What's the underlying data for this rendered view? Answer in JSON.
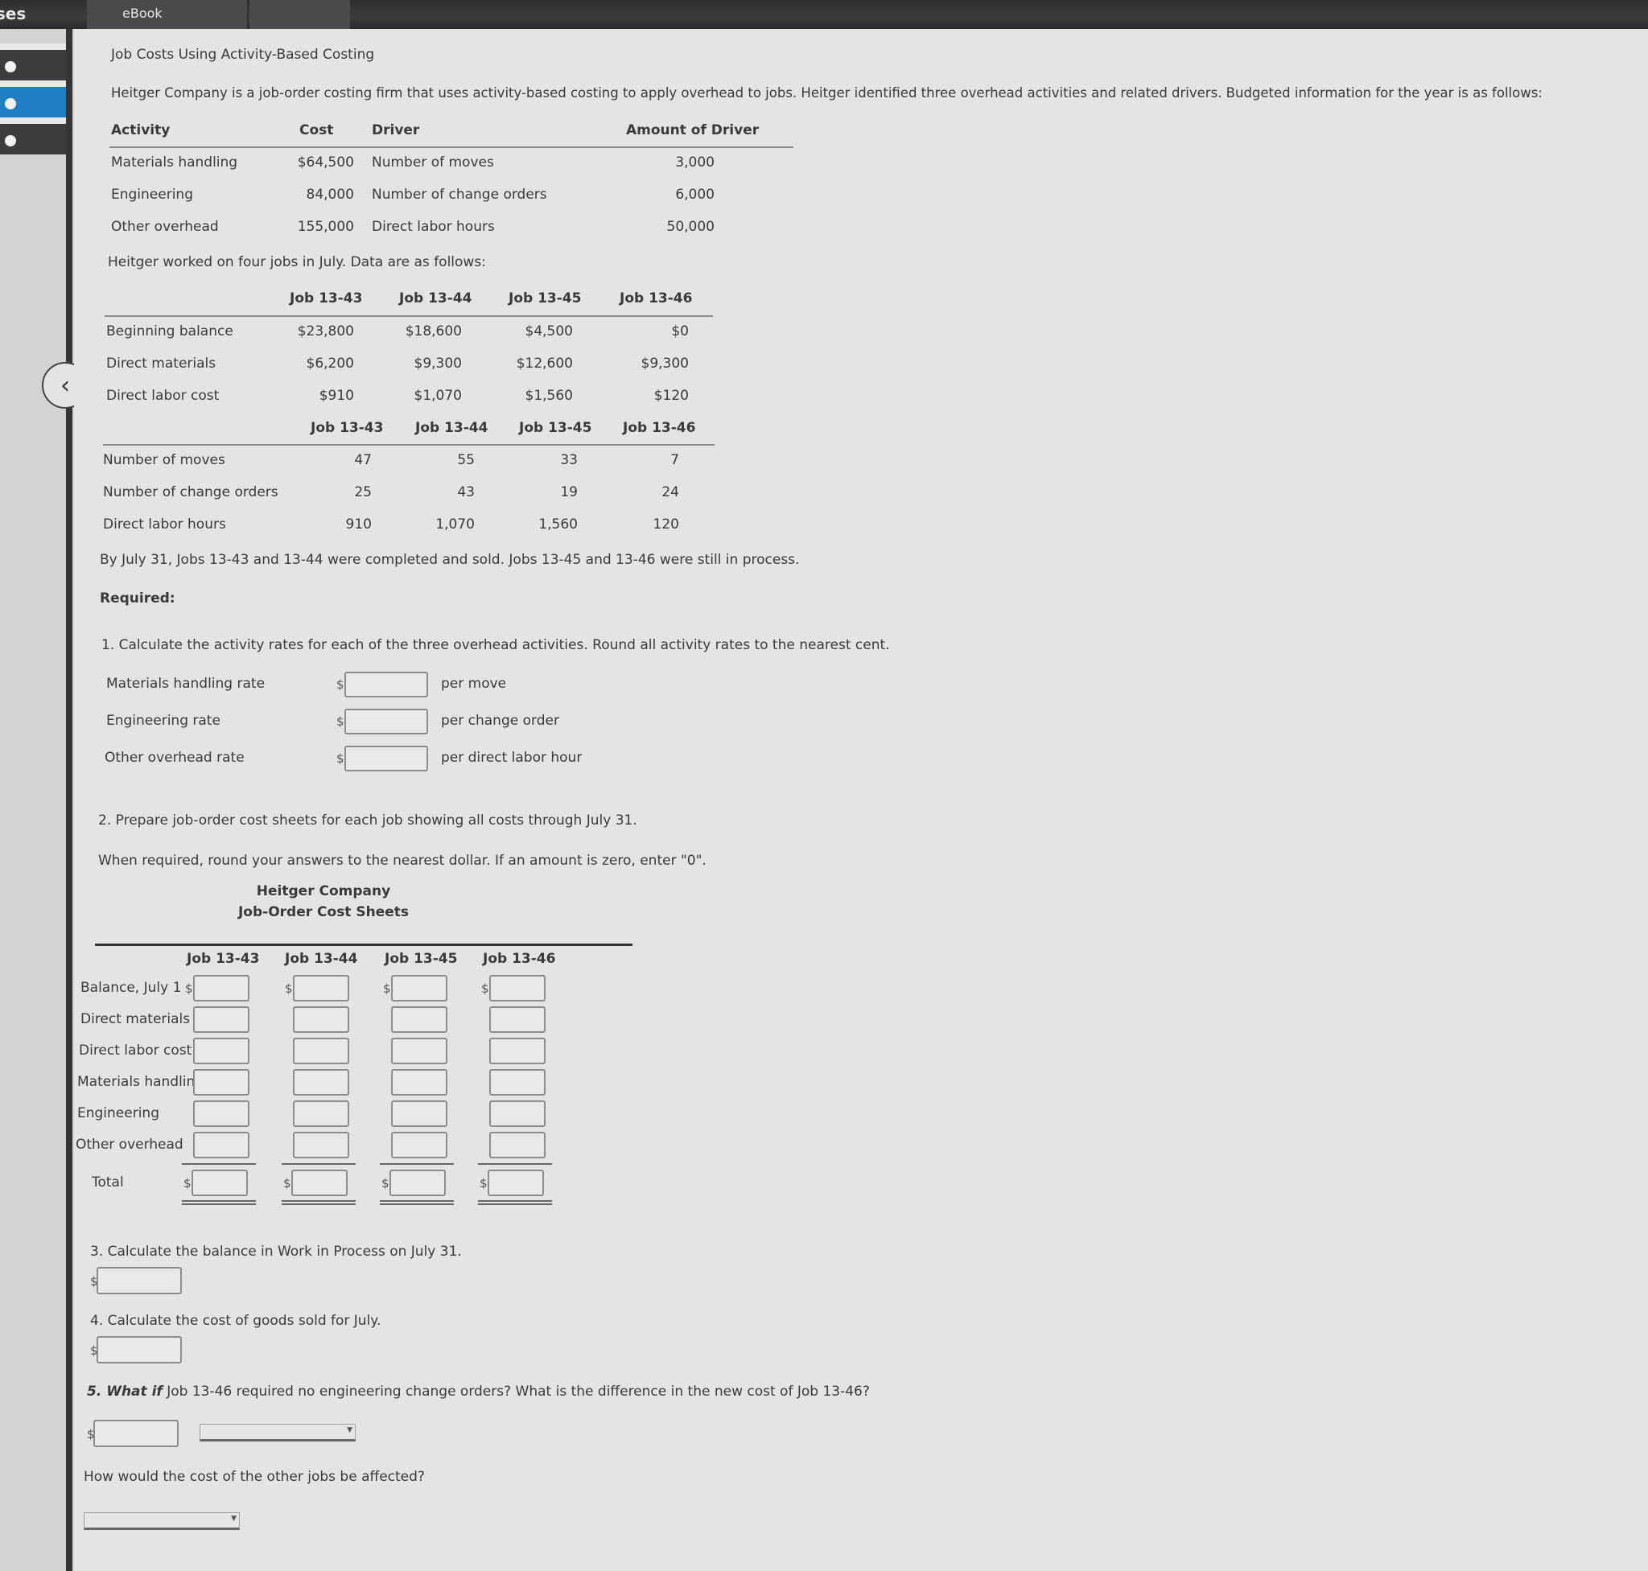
{
  "topbar": {
    "tabs": [
      {
        "label": "Exercises",
        "visible_text": "ises"
      },
      {
        "label": "eBook"
      }
    ]
  },
  "sidebar": {
    "items": [
      {
        "state": "normal"
      },
      {
        "state": "active"
      },
      {
        "state": "normal"
      }
    ],
    "collapse_icon": "chevron-left-icon",
    "colors": {
      "active": "#1e7fc6",
      "normal": "#3c3c3e"
    }
  },
  "problem": {
    "title": "Job Costs Using Activity-Based Costing",
    "intro": "Heitger Company is a job-order costing firm that uses activity-based costing to apply overhead to jobs. Heitger identified three overhead activities and related drivers. Budgeted information for the year is as follows:",
    "activity_table": {
      "headers": [
        "Activity",
        "Cost",
        "Driver",
        "Amount of Driver"
      ],
      "rows": [
        [
          "Materials handling",
          "$64,500",
          "Number of moves",
          "3,000"
        ],
        [
          "Engineering",
          "84,000",
          "Number of change orders",
          "6,000"
        ],
        [
          "Other overhead",
          "155,000",
          "Direct labor hours",
          "50,000"
        ]
      ]
    },
    "jobs_intro": "Heitger worked on four jobs in July. Data are as follows:",
    "jobs_table_1": {
      "headers": [
        "",
        "Job 13-43",
        "Job 13-44",
        "Job 13-45",
        "Job 13-46"
      ],
      "rows": [
        [
          "Beginning balance",
          "$23,800",
          "$18,600",
          "$4,500",
          "$0"
        ],
        [
          "Direct materials",
          "$6,200",
          "$9,300",
          "$12,600",
          "$9,300"
        ],
        [
          "Direct labor cost",
          "$910",
          "$1,070",
          "$1,560",
          "$120"
        ]
      ]
    },
    "jobs_table_2": {
      "headers": [
        "",
        "Job 13-43",
        "Job 13-44",
        "Job 13-45",
        "Job 13-46"
      ],
      "rows": [
        [
          "Number of moves",
          "47",
          "55",
          "33",
          "7"
        ],
        [
          "Number of change orders",
          "25",
          "43",
          "19",
          "24"
        ],
        [
          "Direct labor hours",
          "910",
          "1,070",
          "1,560",
          "120"
        ]
      ]
    },
    "status_note": "By July 31, Jobs 13-43 and 13-44 were completed and sold. Jobs 13-45 and 13-46 were still in process.",
    "required_label": "Required:"
  },
  "q1": {
    "prompt": "1. Calculate the activity rates for each of the three overhead activities. Round all activity rates to the nearest cent.",
    "rows": [
      {
        "label": "Materials handling rate",
        "currency": "$",
        "value": "",
        "unit": "per move"
      },
      {
        "label": "Engineering rate",
        "currency": "$",
        "value": "",
        "unit": "per change order"
      },
      {
        "label": "Other overhead rate",
        "currency": "$",
        "value": "",
        "unit": "per direct labor hour"
      }
    ]
  },
  "q2": {
    "prompt": "2. Prepare job-order cost sheets for each job showing all costs through July 31.",
    "instruction": "When required, round your answers to the nearest dollar. If an amount is zero, enter \"0\".",
    "company": "Heitger Company",
    "sheet_title": "Job-Order Cost Sheets",
    "columns": [
      "Job 13-43",
      "Job 13-44",
      "Job 13-45",
      "Job 13-46"
    ],
    "rows": [
      "Balance, July 1",
      "Direct materials",
      "Direct labor cost",
      "Materials handling",
      "Engineering",
      "Other overhead"
    ],
    "total_label": "Total",
    "currency": "$"
  },
  "q3": {
    "prompt": "3. Calculate the balance in Work in Process on July 31.",
    "currency": "$",
    "value": ""
  },
  "q4": {
    "prompt": "4. Calculate the cost of goods sold for July.",
    "currency": "$",
    "value": ""
  },
  "q5": {
    "prompt_bold": "5. What if",
    "prompt_rest": " Job 13-46 required no engineering change orders? What is the difference in the new cost of Job 13-46?",
    "currency": "$",
    "value": "",
    "direction_selected": "",
    "other_jobs_prompt": "How would the cost of the other jobs be affected?",
    "other_jobs_selected": ""
  }
}
